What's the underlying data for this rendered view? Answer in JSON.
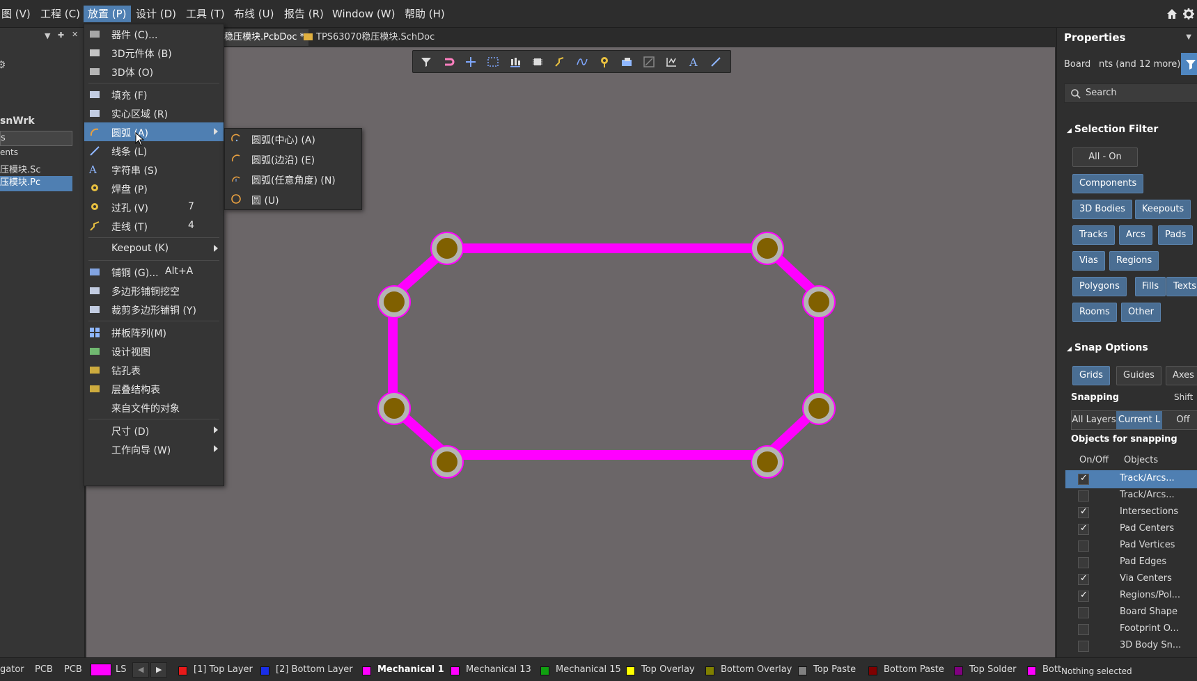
{
  "menubar": {
    "items": [
      "图 (V)",
      "工程 (C)",
      "放置 (P)",
      "设计 (D)",
      "工具 (T)",
      "布线 (U)",
      "报告 (R)",
      "Window (W)",
      "帮助 (H)"
    ],
    "home_icon": "home-icon",
    "settings_icon": "gear-icon"
  },
  "left_panel": {
    "project": "snWrk",
    "input_value": "s",
    "items": [
      "ents",
      "压模块.Sc",
      "压模块.Pc"
    ]
  },
  "tabs": {
    "pcb": "稳压模块.PcbDoc *",
    "sch": "TPS63070稳压模块.SchDoc"
  },
  "place_menu": {
    "items": [
      {
        "label": "器件 (C)...",
        "icon": "component-icon"
      },
      {
        "label": "3D元件体 (B)",
        "icon": "3d-body-icon"
      },
      {
        "label": "3D体 (O)",
        "icon": "3d-object-icon"
      },
      {
        "label": "填充 (F)",
        "icon": "fill-icon"
      },
      {
        "label": "实心区域 (R)",
        "icon": "region-icon"
      },
      {
        "label": "圆弧 (A)",
        "icon": "arc-icon"
      },
      {
        "label": "线条 (L)",
        "icon": "line-icon"
      },
      {
        "label": "字符串 (S)",
        "icon": "text-icon"
      },
      {
        "label": "焊盘 (P)",
        "icon": "pad-icon"
      },
      {
        "label": "过孔 (V)",
        "icon": "via-icon",
        "shortcut": "7"
      },
      {
        "label": "走线 (T)",
        "icon": "track-icon",
        "shortcut": "4"
      },
      {
        "label": "Keepout (K)",
        "icon": ""
      },
      {
        "label": "铺铜 (G)...",
        "icon": "polygon-icon",
        "shortcut": "Alt+A"
      },
      {
        "label": "多边形铺铜挖空",
        "icon": "cutout-icon"
      },
      {
        "label": "裁剪多边形铺铜 (Y)",
        "icon": "slice-icon"
      },
      {
        "label": "拼板阵列(M)",
        "icon": "panel-array-icon"
      },
      {
        "label": "设计视图",
        "icon": "design-view-icon"
      },
      {
        "label": "钻孔表",
        "icon": "drill-table-icon"
      },
      {
        "label": "层叠结构表",
        "icon": "stackup-table-icon"
      },
      {
        "label": "来自文件的对象",
        "icon": ""
      },
      {
        "label": "尺寸 (D)",
        "icon": ""
      },
      {
        "label": "工作向导 (W)",
        "icon": ""
      }
    ]
  },
  "arc_submenu": {
    "items": [
      "圆弧(中心) (A)",
      "圆弧(边沿) (E)",
      "圆弧(任意角度) (N)",
      "圆 (U)"
    ]
  },
  "properties": {
    "title": "Properties",
    "board_label": "Board",
    "board_filter": "nts (and 12 more)",
    "search_placeholder": "Search",
    "selection_filter_title": "Selection Filter",
    "all_on": "All - On",
    "filters": [
      "Components",
      "3D Bodies",
      "Keepouts",
      "Tracks",
      "Arcs",
      "Pads",
      "Vias",
      "Regions",
      "Polygons",
      "Fills",
      "Texts",
      "Rooms",
      "Other"
    ],
    "snap_options_title": "Snap Options",
    "snap_buttons": [
      "Grids",
      "Guides",
      "Axes"
    ],
    "snapping_label": "Snapping",
    "snapping_shortcut": "Shift",
    "snapping_modes": [
      "All Layers",
      "Current L",
      "Off"
    ],
    "objects_title": "Objects for snapping",
    "col_onoff": "On/Off",
    "col_objects": "Objects",
    "objects": [
      {
        "name": "Track/Arcs...",
        "on": true,
        "hl": true
      },
      {
        "name": "Track/Arcs...",
        "on": false
      },
      {
        "name": "Intersections",
        "on": true
      },
      {
        "name": "Pad Centers",
        "on": true
      },
      {
        "name": "Pad Vertices",
        "on": false
      },
      {
        "name": "Pad Edges",
        "on": false
      },
      {
        "name": "Via Centers",
        "on": true
      },
      {
        "name": "Regions/Pol...",
        "on": true
      },
      {
        "name": "Board Shape",
        "on": false
      },
      {
        "name": "Footprint O...",
        "on": false
      },
      {
        "name": "3D Body Sn...",
        "on": false
      }
    ],
    "status": "Nothing selected"
  },
  "layerbar": {
    "left_tabs": [
      "gator",
      "PCB",
      "PCB"
    ],
    "ls": "LS",
    "layers": [
      {
        "name": "[1] Top Layer",
        "color": "#e81a1a"
      },
      {
        "name": "[2] Bottom Layer",
        "color": "#1a2ee8"
      },
      {
        "name": "Mechanical 1",
        "color": "#ff00ff"
      },
      {
        "name": "Mechanical 13",
        "color": "#ff00ff"
      },
      {
        "name": "Mechanical 15",
        "color": "#10a010"
      },
      {
        "name": "Top Overlay",
        "color": "#ffff00"
      },
      {
        "name": "Bottom Overlay",
        "color": "#808000"
      },
      {
        "name": "Top Paste",
        "color": "#808080"
      },
      {
        "name": "Bottom Paste",
        "color": "#800000"
      },
      {
        "name": "Top Solder",
        "color": "#800080"
      },
      {
        "name": "Bott",
        "color": "#ff00ff"
      }
    ]
  },
  "colors": {
    "accent": "#4f7fb2",
    "board_outline": "#ff00ff",
    "pad_copper": "#806000"
  }
}
